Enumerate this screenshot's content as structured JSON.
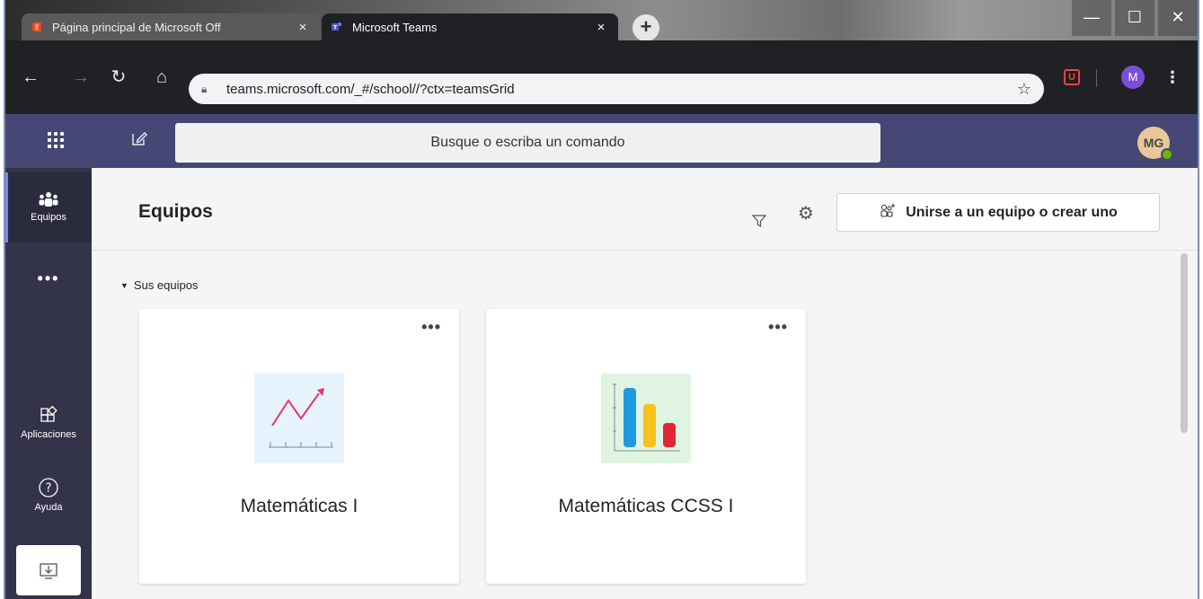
{
  "browser": {
    "tabs": [
      {
        "title": "Página principal de Microsoft Off",
        "close": "×",
        "favicon": "office-icon",
        "active": false
      },
      {
        "title": "Microsoft Teams",
        "close": "×",
        "favicon": "teams-icon",
        "active": true
      }
    ],
    "new_tab": "+",
    "window_controls": {
      "minimize": "—",
      "maximize": "☐",
      "close": "✕"
    },
    "url": "teams.microsoft.com/_#/school//?ctx=teamsGrid",
    "profile_initial": "M"
  },
  "teams": {
    "search_placeholder": "Busque o escriba un comando",
    "avatar_initials": "MG",
    "accent_color": "#464775",
    "rail": {
      "teams_label": "Equipos",
      "apps_label": "Aplicaciones",
      "help_label": "Ayuda",
      "more": "•••"
    },
    "main": {
      "title": "Equipos",
      "join_button": "Unirse a un equipo o crear uno",
      "section_label": "Sus equipos",
      "cards": [
        {
          "name": "Matemáticas I",
          "more": "•••",
          "icon": "line-chart-icon"
        },
        {
          "name": "Matemáticas CCSS I",
          "more": "•••",
          "icon": "bar-chart-icon"
        }
      ]
    }
  }
}
